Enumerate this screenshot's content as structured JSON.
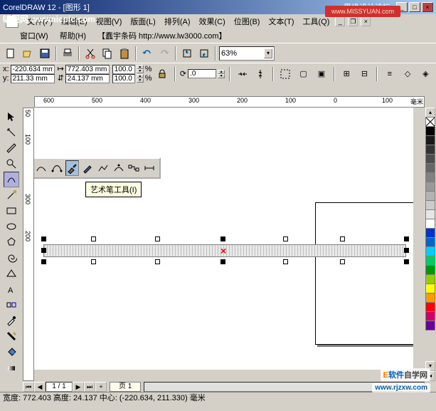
{
  "title": "CorelDRAW 12 - [图形 1]",
  "overlay_url": "昵图网  wwwnicpic.com",
  "top_right_text": "思缘设计论坛",
  "watermark_host": "www.MISSYUAN.com",
  "menus": {
    "file": "文件(F)",
    "edit": "编辑(E)",
    "view": "视图(V)",
    "layout": "版面(L)",
    "arrange": "排列(A)",
    "effects": "效果(C)",
    "bitmaps": "位图(B)",
    "text": "文本(T)",
    "tools": "工具(Q)",
    "window": "窗口(W)",
    "help": "帮助(H)",
    "ad": "【蠢宇条码 http://www.lw3000.com】"
  },
  "zoom": "63%",
  "coords": {
    "x": "-220.634 mm",
    "y": "211.33 mm"
  },
  "size": {
    "w": "772.403 mm",
    "h": "24.137 mm"
  },
  "scale": {
    "x": "100.0",
    "y": "100.0",
    "unit": "%"
  },
  "rotation": ".0",
  "ruler_unit": "毫米",
  "ruler_h": [
    "600",
    "500",
    "400",
    "300",
    "200",
    "100",
    "0",
    "100"
  ],
  "ruler_v": [
    "50",
    "100",
    "200",
    "300"
  ],
  "tooltip": "艺术笔工具(I)",
  "page_nav": {
    "current": "1 / 1",
    "tab": "页 1"
  },
  "status": "宽度:  772.403 高度:  24.137 中心: (-220.634, 211.330) 毫米",
  "watermark1_a": "软件",
  "watermark1_b": "自学网",
  "watermark2": "www.rjzxw.com",
  "colors": [
    "transparent",
    "#000000",
    "#ffffff",
    "#1a1a1a",
    "#333333",
    "#4d4d4d",
    "#666666",
    "#808080",
    "#999999",
    "#b3b3b3",
    "#cccccc",
    "#e6e6e6",
    "#003399",
    "#0066cc",
    "#0099ff",
    "#009933",
    "#ffff00",
    "#ff9900",
    "#ff0000",
    "#cc0066",
    "#660099"
  ]
}
